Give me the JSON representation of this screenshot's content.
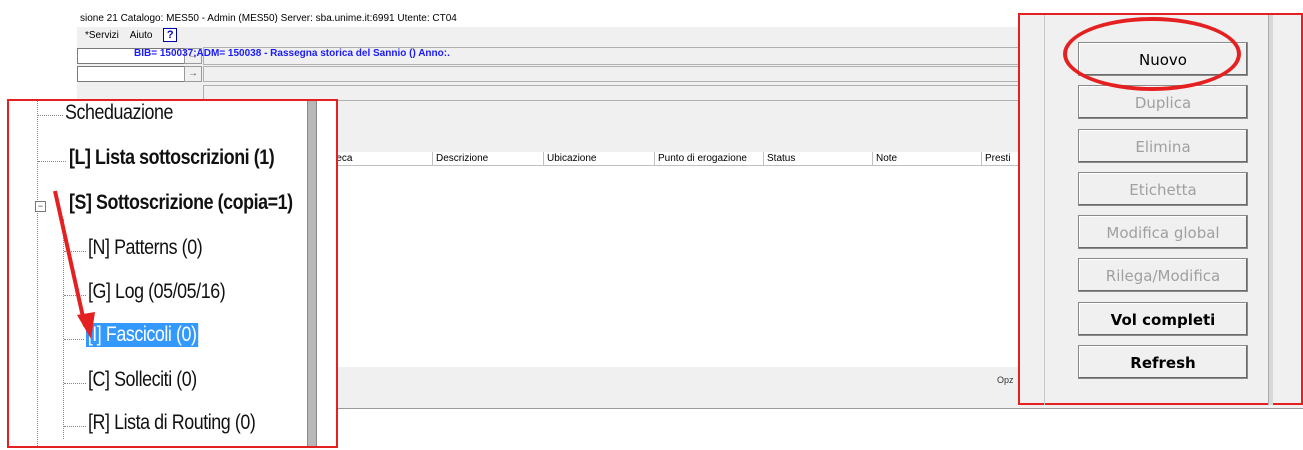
{
  "window": {
    "title": "sione 21  Catalogo:  MES50 - Admin (MES50)  Server:  sba.unime.it:6991  Utente:  CT04",
    "menu": [
      "*Servizi",
      "Aiuto"
    ],
    "help_icon_glyph": "?"
  },
  "record": {
    "label": "BIB= 150037;ADM= 150038 - Rassegna storica del Sannio () Anno:."
  },
  "table": {
    "columns": [
      "blioteca",
      "Descrizione",
      "Ubicazione",
      "Punto di erogazione",
      "Status",
      "Note",
      "Presti"
    ]
  },
  "footer": {
    "opz_label": "Opz"
  },
  "tree": {
    "items": [
      {
        "label": "Scheduazione",
        "bold": false
      },
      {
        "label": "[L] Lista sottoscrizioni (1)",
        "bold": true
      },
      {
        "label": "[S] Sottoscrizione (copia=1)",
        "bold": true
      },
      {
        "label": "[N] Patterns (0)",
        "bold": false
      },
      {
        "label": "[G] Log (05/05/16)",
        "bold": false
      },
      {
        "label": "[I] Fascicoli (0)",
        "bold": false,
        "selected": true
      },
      {
        "label": "[C] Solleciti (0)",
        "bold": false
      },
      {
        "label": "[R] Lista di Routing (0)",
        "bold": false
      }
    ],
    "collapse_glyph": "−"
  },
  "actions": {
    "buttons": [
      {
        "label": "Nuovo",
        "enabled": true,
        "bold": false
      },
      {
        "label": "Duplica",
        "enabled": false,
        "bold": false
      },
      {
        "label": "Elimina",
        "enabled": false,
        "bold": false
      },
      {
        "label": "Etichetta",
        "enabled": false,
        "bold": false
      },
      {
        "label": "Modifica global",
        "enabled": false,
        "bold": false
      },
      {
        "label": "Rilega/Modifica",
        "enabled": false,
        "bold": false
      },
      {
        "label": "Vol completi",
        "enabled": true,
        "bold": true
      },
      {
        "label": "Refresh",
        "enabled": true,
        "bold": true
      }
    ]
  },
  "colors": {
    "highlight": "#e52020",
    "selection": "#3399ff",
    "link": "#1a1aff"
  }
}
